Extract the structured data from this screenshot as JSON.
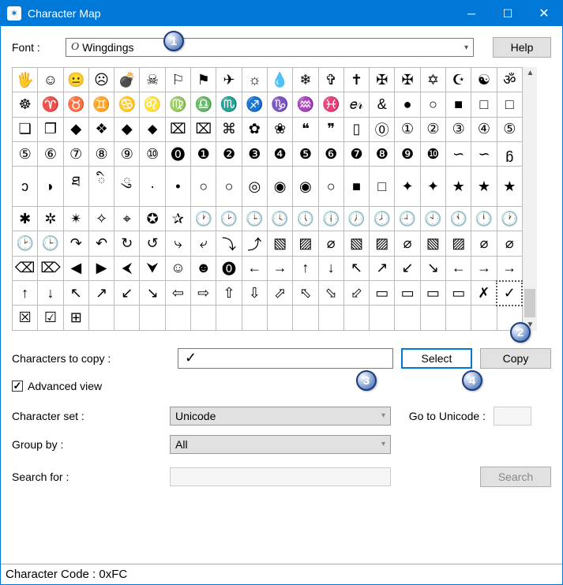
{
  "window": {
    "title": "Character Map"
  },
  "font": {
    "label": "Font :",
    "value": "Wingdings"
  },
  "help": {
    "label": "Help"
  },
  "grid": {
    "rows": [
      [
        "🖐",
        "☺",
        "😐",
        "☹",
        "💣",
        "☠",
        "⚐",
        "⚑",
        "✈",
        "☼",
        "💧",
        "❄",
        "✞",
        "✝",
        "✠",
        "✠",
        "✡",
        "☪",
        "☯",
        "ॐ"
      ],
      [
        "☸",
        "♈",
        "♉",
        "♊",
        "♋",
        "♌",
        "♍",
        "♎",
        "♏",
        "♐",
        "♑",
        "♒",
        "♓",
        "𝑒𝓇",
        "&",
        "●",
        "○",
        "■",
        "□",
        "□"
      ],
      [
        "❏",
        "❐",
        "◆",
        "❖",
        "◆",
        "⬥",
        "⌧",
        "⌧",
        "⌘",
        "✿",
        "❀",
        "❝",
        "❞",
        "▯",
        "⓪",
        "①",
        "②",
        "③",
        "④",
        "⑤"
      ],
      [
        "⑤",
        "⑥",
        "⑦",
        "⑧",
        "⑨",
        "⑩",
        "⓿",
        "❶",
        "❷",
        "❸",
        "❹",
        "❺",
        "❻",
        "❼",
        "❽",
        "❾",
        "❿",
        "∽",
        "∽",
        "ᵷ"
      ],
      [
        "ᴐ",
        "◗",
        "ཐ",
        "ི",
        "ུ",
        "·",
        "•",
        "○",
        "○",
        "◎",
        "◉",
        "◉",
        "○",
        "■",
        "□",
        "✦",
        "✦",
        "★",
        "★",
        "★"
      ],
      [
        "✱",
        "✲",
        "✴",
        "✧",
        "⌖",
        "✪",
        "✰",
        "🕐",
        "🕑",
        "🕒",
        "🕓",
        "🕔",
        "🕕",
        "🕖",
        "🕗",
        "🕘",
        "🕙",
        "🕚",
        "🕛",
        "🕐"
      ],
      [
        "🕑",
        "🕒",
        "↷",
        "↶",
        "↻",
        "↺",
        "⤷",
        "⤶",
        "⤵",
        "⤴",
        "▧",
        "▨",
        "⌀",
        "▧",
        "▨",
        "⌀",
        "▧",
        "▨",
        "⌀",
        "⌀"
      ],
      [
        "⌫",
        "⌦",
        "◀",
        "▶",
        "⮜",
        "⮟",
        "☺",
        "☻",
        "⓿",
        "←",
        "→",
        "↑",
        "↓",
        "↖",
        "↗",
        "↙",
        "↘",
        "←",
        "→",
        "→"
      ],
      [
        "↑",
        "↓",
        "↖",
        "↗",
        "↙",
        "↘",
        "⇦",
        "⇨",
        "⇧",
        "⇩",
        "⬀",
        "⬁",
        "⬂",
        "⬃",
        "▭",
        "▭",
        "▭",
        "▭",
        "✗",
        "✓"
      ],
      [
        "☒",
        "☑",
        "⊞",
        "",
        "",
        "",
        "",
        "",
        "",
        "",
        "",
        "",
        "",
        "",
        "",
        "",
        "",
        "",
        "",
        ""
      ]
    ],
    "selected": {
      "row": 8,
      "col": 19
    }
  },
  "copy": {
    "label": "Characters to copy :",
    "value": "✓",
    "select": "Select",
    "copy": "Copy"
  },
  "advanced": {
    "label": "Advanced view",
    "checked": true
  },
  "charset": {
    "label": "Character set :",
    "value": "Unicode"
  },
  "gotounicode": {
    "label": "Go to Unicode :"
  },
  "groupby": {
    "label": "Group by :",
    "value": "All"
  },
  "search": {
    "label": "Search for :",
    "button": "Search"
  },
  "status": {
    "text": "Character Code : 0xFC"
  },
  "callouts": {
    "c1": "1",
    "c2": "2",
    "c3": "3",
    "c4": "4"
  }
}
